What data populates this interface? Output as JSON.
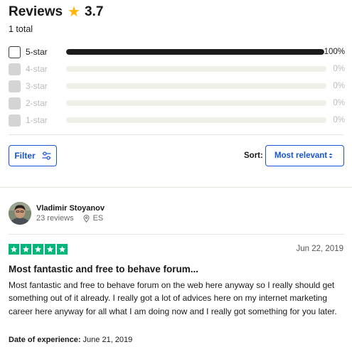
{
  "header": {
    "title": "Reviews",
    "star_icon": "star-icon",
    "rating": "3.7",
    "total": "1 total"
  },
  "distribution": [
    {
      "label": "5-star",
      "percent_text": "100%",
      "fraction": 1.0,
      "enabled": true
    },
    {
      "label": "4-star",
      "percent_text": "0%",
      "fraction": 0.0,
      "enabled": false
    },
    {
      "label": "3-star",
      "percent_text": "0%",
      "fraction": 0.0,
      "enabled": false
    },
    {
      "label": "2-star",
      "percent_text": "0%",
      "fraction": 0.0,
      "enabled": false
    },
    {
      "label": "1-star",
      "percent_text": "0%",
      "fraction": 0.0,
      "enabled": false
    }
  ],
  "controls": {
    "filter_label": "Filter",
    "filter_icon": "sliders-icon",
    "sort_label": "Sort:",
    "sort_value": "Most relevant",
    "sort_icon": "sort-arrows-icon"
  },
  "review": {
    "reviewer_name": "Vladimir Stoyanov",
    "review_count": "23 reviews",
    "country": "ES",
    "rating_stars": 5,
    "date": "Jun 22, 2019",
    "title": "Most fantastic and free to behave forum...",
    "body": "Most fantastic and free to behave forum on the web here anyway so I really should get something out of it already. I really got a lot of advices here on my internet marketing career here anyway for all what I am doing now and I really got something for you later.",
    "experience_label": "Date of experience:",
    "experience_date": "June 21, 2019"
  },
  "colors": {
    "accent": "#1954d1",
    "star_yellow": "#ffb400",
    "trust_green": "#00b67a",
    "bar_fill": "#1c1c1c",
    "bar_track": "#efeee7"
  }
}
